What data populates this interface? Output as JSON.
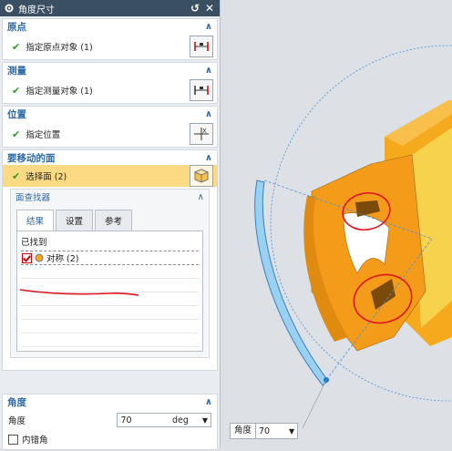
{
  "dialog": {
    "title": "角度尺寸",
    "reset_icon": "reset-icon",
    "close_icon": "close-icon"
  },
  "origin": {
    "header": "原点",
    "row_label": "指定原点对象 (1)"
  },
  "measure": {
    "header": "测量",
    "row_label": "指定测量对象 (1)"
  },
  "position": {
    "header": "位置",
    "row_label": "指定位置"
  },
  "faces": {
    "header": "要移动的面",
    "row_label": "选择面 (2)",
    "finder": {
      "header": "面查找器",
      "tabs": [
        "结果",
        "设置",
        "参考"
      ],
      "found_header": "已找到",
      "items": [
        "对称 (2)"
      ]
    }
  },
  "angle": {
    "header": "角度",
    "label": "角度",
    "value": "70",
    "unit": "deg",
    "inner_angle_label": "内错角"
  },
  "viewport": {
    "angle_label": "角度",
    "angle_value": "70"
  },
  "colors": {
    "title_bar": "#3b4f63",
    "section_header": "#2e6aa8",
    "highlight": "#fcd983",
    "part_orange": "#f59b1a",
    "check_green": "#2a9d2a"
  }
}
